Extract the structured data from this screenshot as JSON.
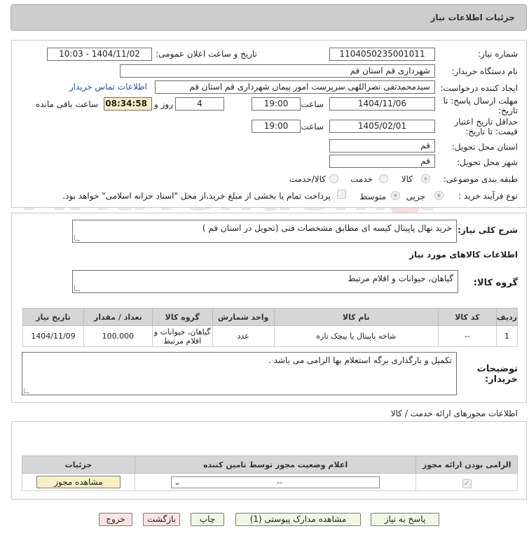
{
  "header": {
    "title": "جزئیات اطلاعات نیاز"
  },
  "watermark": {
    "text": "AriaTender.net"
  },
  "form": {
    "need_number": {
      "label": "شماره نیاز:",
      "value": "1104050235001011"
    },
    "announce": {
      "label": "تاریخ و ساعت اعلان عمومی:",
      "value": "1404/11/02 - 10:03"
    },
    "buyer_org": {
      "label": "نام دستگاه خریدار:",
      "value": "شهرداری قم استان قم"
    },
    "requester": {
      "label": "ایجاد کننده درخواست:",
      "value": "سیدمحمدتقی نصراللهی سرپرست امور پیمان شهرداری قم استان قم",
      "contact_link": "اطلاعات تماس خریدار"
    },
    "deadline": {
      "label_line1": "مهلت ارسال پاسخ: تا",
      "label_line2": "تاریخ:",
      "date": "1404/11/06",
      "time_label": "ساعت",
      "time": "19:00",
      "days": "4",
      "days_label": "روز و",
      "remaining": "08:34:58",
      "remaining_label": "ساعت باقی مانده"
    },
    "validity": {
      "label_line1": "حداقل تاریخ اعتبار",
      "label_line2": "قیمت: تا تاریخ:",
      "date": "1405/02/01",
      "time_label": "ساعت",
      "time": "19:00"
    },
    "delivery_province": {
      "label": "استان محل تحویل:",
      "value": "قم"
    },
    "delivery_city": {
      "label": "شهر محل تحویل:",
      "value": "قم"
    },
    "category": {
      "label": "طبقه بندی موضوعی:",
      "options": [
        "کالا",
        "خدمت",
        "کالا/خدمت"
      ],
      "selected": "کالا"
    },
    "process": {
      "label": "نوع فرآیند خرید :",
      "options": [
        "جزیی",
        "متوسط"
      ],
      "selected": "جزیی",
      "note": "پرداخت تمام یا بخشی از مبلغ خرید،از محل \"اسناد خزانه اسلامی\" خواهد بود."
    }
  },
  "summary": {
    "label": "شرح کلی نیاز:",
    "value": "خرید نهال پاپیتال کیسه ای مطابق مشخصات فنی (تحویل در استان قم )"
  },
  "goods": {
    "section_title": "اطلاعات کالاهای مورد نیاز",
    "group_label": "گروه کالا:",
    "group_value": "گیاهان، حیوانات و اقلام مرتبط",
    "columns": [
      "ردیف",
      "کد کالا",
      "نام کالا",
      "واحد شمارش",
      "گروه کالا",
      "تعداد / مقدار",
      "تاریخ نیاز"
    ],
    "rows": [
      [
        "1",
        "--",
        "شاخه پاپیتال یا پیچک تازه",
        "عدد",
        "گیاهان، حیوانات و اقلام مرتبط",
        "100,000",
        "1404/11/09"
      ]
    ]
  },
  "buyer_notes": {
    "label_line1": "توضیحات",
    "label_line2": "خریدار:",
    "value": "تکمیل و بارگذاری برگه استعلام بها الزامی می باشد ."
  },
  "permits": {
    "section_title": "اطلاعات مجوزهای ارائه خدمت / کالا",
    "columns": [
      "الزامی بودن ارائه مجوز",
      "اعلام وضعیت مجوز توسط تامین کننده",
      "جزئیات"
    ],
    "select_value": "--",
    "view_button": "مشاهده مجوز"
  },
  "footer": {
    "reply": "پاسخ به نیاز",
    "attachments": "مشاهده مدارک پیوستی (1)",
    "print": "چاپ",
    "back": "بازگشت",
    "exit": "خروج"
  },
  "colors": {
    "header_bg": "#cdcdcd",
    "remaining_bg": "#f6f0c4",
    "button_green": "#eef7e4",
    "button_pink": "#fbe3e3",
    "link": "#1c55a8"
  }
}
